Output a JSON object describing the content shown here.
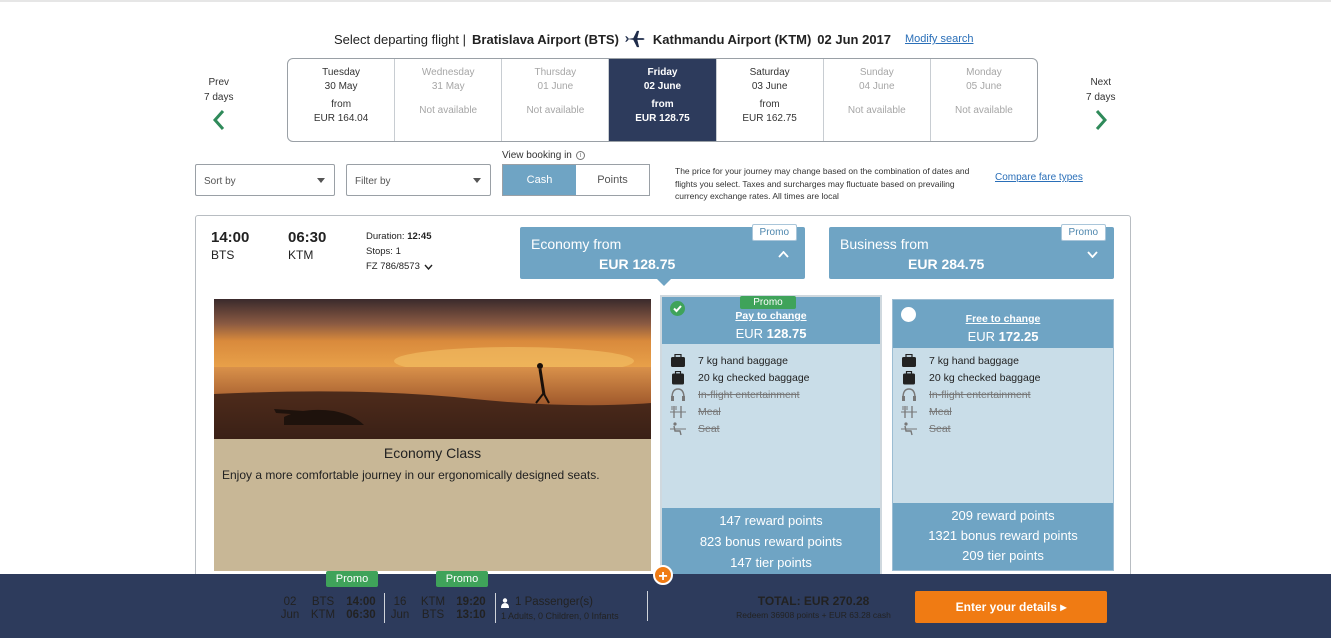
{
  "header": {
    "prefix": "Select departing flight |",
    "origin": "Bratislava Airport (BTS)",
    "destination": "Kathmandu Airport (KTM)",
    "date": "02 Jun 2017",
    "modify_link": "Modify search",
    "plane_icon": "plane-icon"
  },
  "nav": {
    "prev": [
      "Prev",
      "7 days"
    ],
    "next": [
      "Next",
      "7 days"
    ],
    "accent": "#2f8a5a"
  },
  "dates": [
    {
      "weekday": "Tuesday",
      "date": "30 May",
      "from": "from",
      "price": "EUR 164.04",
      "available": true,
      "selected": false
    },
    {
      "weekday": "Wednesday",
      "date": "31 May",
      "status": "Not available",
      "available": false,
      "selected": false
    },
    {
      "weekday": "Thursday",
      "date": "01 June",
      "status": "Not available",
      "available": false,
      "selected": false
    },
    {
      "weekday": "Friday",
      "date": "02 June",
      "from": "from",
      "price": "EUR 128.75",
      "available": true,
      "selected": true
    },
    {
      "weekday": "Saturday",
      "date": "03 June",
      "from": "from",
      "price": "EUR 162.75",
      "available": true,
      "selected": false
    },
    {
      "weekday": "Sunday",
      "date": "04 June",
      "status": "Not available",
      "available": false,
      "selected": false
    },
    {
      "weekday": "Monday",
      "date": "05 June",
      "status": "Not available",
      "available": false,
      "selected": false
    }
  ],
  "controls": {
    "sort_label": "Sort by",
    "filter_label": "Filter by",
    "view_booking": "View booking in",
    "cash": "Cash",
    "points": "Points",
    "disclaimer": "The price for your journey may change based on the combination of dates and flights you select. Taxes and surcharges may fluctuate based on prevailing currency exchange rates. All times are local",
    "compare": "Compare fare types"
  },
  "flight": {
    "depart_time": "14:00",
    "depart_code": "BTS",
    "arrive_time": "06:30",
    "arrive_code": "KTM",
    "duration_label": "Duration:",
    "duration": "12:45",
    "stops": "Stops: 1",
    "flight_no": "FZ 786/8573"
  },
  "cabins": {
    "economy": {
      "label": "Economy from",
      "price": "EUR 128.75",
      "promo": "Promo"
    },
    "business": {
      "label": "Business from",
      "price": "EUR 284.75",
      "promo": "Promo"
    }
  },
  "class_info": {
    "title": "Economy Class",
    "description": "Enjoy a more comfortable journey in our ergonomically designed seats."
  },
  "fares": [
    {
      "promo": "Promo",
      "name": "Pay to change",
      "currency": "EUR",
      "amount": "128.75",
      "selected": true,
      "features": [
        {
          "icon": "hand-baggage-icon",
          "text": "7 kg hand baggage",
          "included": true
        },
        {
          "icon": "checked-baggage-icon",
          "text": "20 kg checked baggage",
          "included": true
        },
        {
          "icon": "headphones-icon",
          "text": "In-flight entertainment",
          "included": false
        },
        {
          "icon": "meal-icon",
          "text": "Meal",
          "included": false
        },
        {
          "icon": "seat-icon",
          "text": "Seat",
          "included": false
        }
      ],
      "rewards": [
        "147 reward points",
        "823 bonus reward points",
        "147 tier points"
      ]
    },
    {
      "name": "Free to change",
      "currency": "EUR",
      "amount": "172.25",
      "selected": false,
      "features": [
        {
          "icon": "hand-baggage-icon",
          "text": "7 kg hand baggage",
          "included": true
        },
        {
          "icon": "checked-baggage-icon",
          "text": "20 kg checked baggage",
          "included": true
        },
        {
          "icon": "headphones-icon",
          "text": "In-flight entertainment",
          "included": false
        },
        {
          "icon": "meal-icon",
          "text": "Meal",
          "included": false
        },
        {
          "icon": "seat-icon",
          "text": "Seat",
          "included": false
        }
      ],
      "rewards": [
        "209 reward points",
        "1321 bonus reward points",
        "209 tier points"
      ]
    }
  ],
  "summary": {
    "leg1": {
      "day": "02",
      "month": "Jun",
      "from": "BTS",
      "to": "KTM",
      "dep": "14:00",
      "arr": "06:30",
      "promo": "Promo"
    },
    "leg2": {
      "day": "16",
      "month": "Jun",
      "from": "KTM",
      "to": "BTS",
      "dep": "19:20",
      "arr": "13:10",
      "promo": "Promo"
    },
    "passengers": "1 Passenger(s)",
    "passenger_detail": "1 Adults, 0 Children, 0 Infants",
    "total": "TOTAL: EUR 270.28",
    "redeem": "Redeem 36908 points + EUR 63.28 cash",
    "cta": "Enter your details ▸",
    "plus": "+"
  },
  "colors": {
    "navy": "#2d3b5c",
    "fare_blue": "#6fa4c4",
    "fare_light": "#c9dde8",
    "promo_green": "#3fa35a",
    "cta_orange": "#f07b13",
    "sand": "#c8b796"
  }
}
